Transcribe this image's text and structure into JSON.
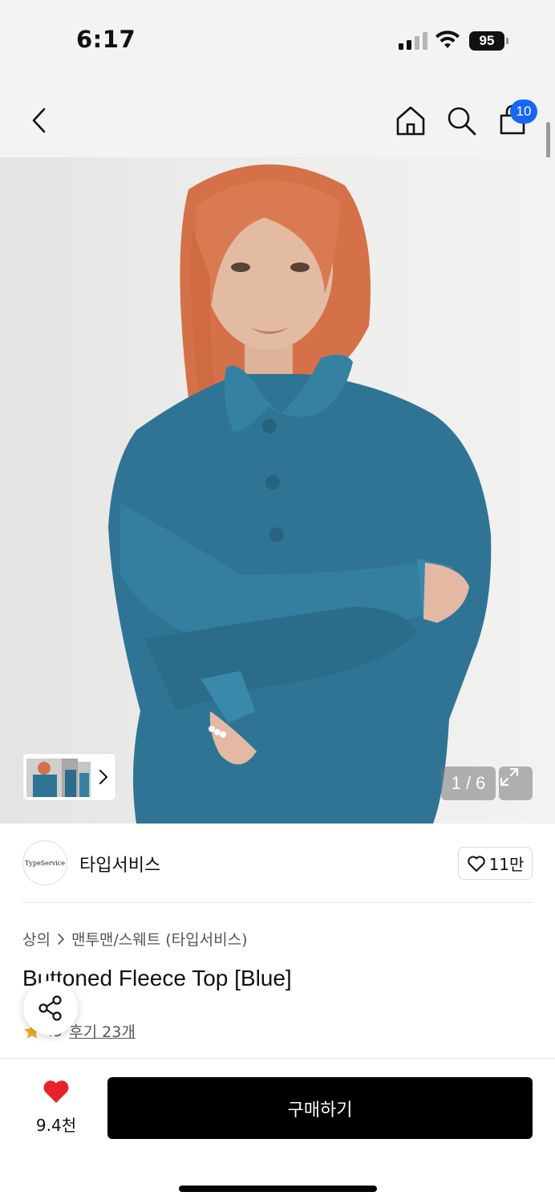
{
  "status_bar": {
    "time": "6:17",
    "battery": "95"
  },
  "nav": {
    "icons": [
      "back-icon",
      "home-icon",
      "search-icon",
      "cart-icon"
    ],
    "cart_count": "10"
  },
  "gallery": {
    "page_counter": "1 / 6",
    "colors": {
      "sweater": "#2f7494",
      "hair": "#d9784f",
      "background": "#ececea"
    }
  },
  "brand": {
    "logo_text": "TypeService",
    "name": "타입서비스",
    "likes": "11만"
  },
  "product": {
    "breadcrumb": [
      "상의",
      "맨투맨/스웨트 (타입서비스)"
    ],
    "title": "Buttoned Fleece Top [Blue]",
    "rating": ".9",
    "reviews": "후기 23개"
  },
  "bottom_bar": {
    "wish_count": "9.4천",
    "buy_label": "구매하기",
    "accent": "#e8222a"
  }
}
